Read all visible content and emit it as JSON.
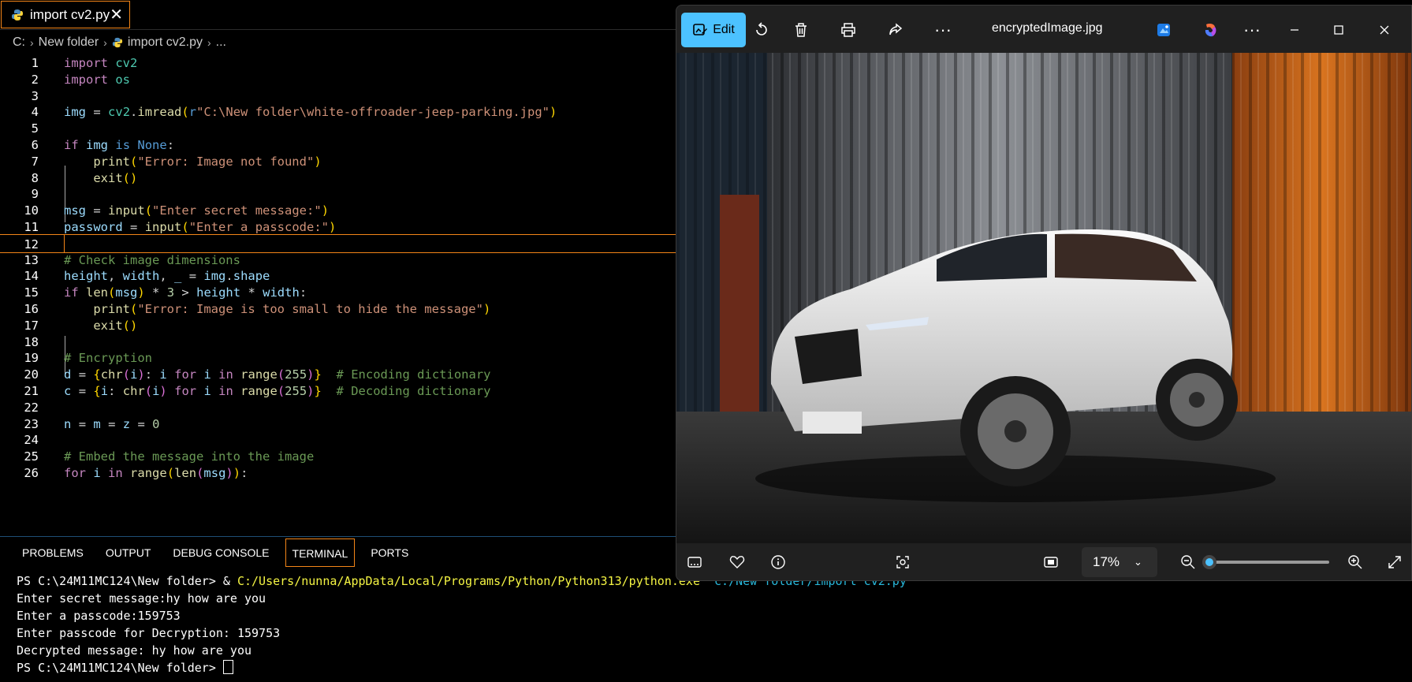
{
  "editor": {
    "tab": {
      "label": "import cv2.py",
      "close": "✕"
    },
    "breadcrumb": [
      "C:",
      "New folder",
      "import cv2.py",
      "..."
    ],
    "lines": [
      {
        "n": "1",
        "html": "<span class='kw'>import</span> <span class='mod'>cv2</span>"
      },
      {
        "n": "2",
        "html": "<span class='kw'>import</span> <span class='mod'>os</span>"
      },
      {
        "n": "3",
        "html": ""
      },
      {
        "n": "4",
        "html": "<span class='var'>img</span> <span class='op'>=</span> <span class='mod'>cv2</span>.<span class='fn'>imread</span><span class='br1'>(</span><span class='kw2'>r</span><span class='str'>\"C:\\New folder\\white-offroader-jeep-parking.jpg\"</span><span class='br1'>)</span>"
      },
      {
        "n": "5",
        "html": ""
      },
      {
        "n": "6",
        "html": "<span class='kw'>if</span> <span class='var'>img</span> <span class='kw2'>is</span> <span class='kw2'>None</span>:"
      },
      {
        "n": "7",
        "html": "    <span class='fn'>print</span><span class='br1'>(</span><span class='str'>\"Error: Image not found\"</span><span class='br1'>)</span>"
      },
      {
        "n": "8",
        "html": "    <span class='fn'>exit</span><span class='br1'>()</span>"
      },
      {
        "n": "9",
        "html": ""
      },
      {
        "n": "10",
        "html": "<span class='var'>msg</span> <span class='op'>=</span> <span class='fn'>input</span><span class='br1'>(</span><span class='str'>\"Enter secret message:\"</span><span class='br1'>)</span>"
      },
      {
        "n": "11",
        "html": "<span class='var'>password</span> <span class='op'>=</span> <span class='fn'>input</span><span class='br1'>(</span><span class='str'>\"Enter a passcode:\"</span><span class='br1'>)</span>"
      },
      {
        "n": "12",
        "html": "",
        "cur": true
      },
      {
        "n": "13",
        "html": "<span class='cm'># Check image dimensions</span>"
      },
      {
        "n": "14",
        "html": "<span class='var'>height</span>, <span class='var'>width</span>, <span class='var'>_</span> <span class='op'>=</span> <span class='var'>img</span>.<span class='var'>shape</span>"
      },
      {
        "n": "15",
        "html": "<span class='kw'>if</span> <span class='fn'>len</span><span class='br1'>(</span><span class='var'>msg</span><span class='br1'>)</span> <span class='op'>*</span> <span class='num'>3</span> <span class='op'>&gt;</span> <span class='var'>height</span> <span class='op'>*</span> <span class='var'>width</span>:"
      },
      {
        "n": "16",
        "html": "    <span class='fn'>print</span><span class='br1'>(</span><span class='str'>\"Error: Image is too small to hide the message\"</span><span class='br1'>)</span>"
      },
      {
        "n": "17",
        "html": "    <span class='fn'>exit</span><span class='br1'>()</span>"
      },
      {
        "n": "18",
        "html": ""
      },
      {
        "n": "19",
        "html": "<span class='cm'># Encryption</span>"
      },
      {
        "n": "20",
        "html": "<span class='var'>d</span> <span class='op'>=</span> <span class='br1'>{</span><span class='fn'>chr</span><span class='br2'>(</span><span class='var'>i</span><span class='br2'>)</span>: <span class='var'>i</span> <span class='kw'>for</span> <span class='var'>i</span> <span class='kw'>in</span> <span class='fn'>range</span><span class='br2'>(</span><span class='num'>255</span><span class='br2'>)</span><span class='br1'>}</span>  <span class='cm'># Encoding dictionary</span>"
      },
      {
        "n": "21",
        "html": "<span class='var'>c</span> <span class='op'>=</span> <span class='br1'>{</span><span class='var'>i</span>: <span class='fn'>chr</span><span class='br2'>(</span><span class='var'>i</span><span class='br2'>)</span> <span class='kw'>for</span> <span class='var'>i</span> <span class='kw'>in</span> <span class='fn'>range</span><span class='br2'>(</span><span class='num'>255</span><span class='br2'>)</span><span class='br1'>}</span>  <span class='cm'># Decoding dictionary</span>"
      },
      {
        "n": "22",
        "html": ""
      },
      {
        "n": "23",
        "html": "<span class='var'>n</span> <span class='op'>=</span> <span class='var'>m</span> <span class='op'>=</span> <span class='var'>z</span> <span class='op'>=</span> <span class='num'>0</span>"
      },
      {
        "n": "24",
        "html": ""
      },
      {
        "n": "25",
        "html": "<span class='cm'># Embed the message into the image</span>"
      },
      {
        "n": "26",
        "html": "<span class='kw'>for</span> <span class='var'>i</span> <span class='kw'>in</span> <span class='fn'>range</span><span class='br1'>(</span><span class='fn'>len</span><span class='br2'>(</span><span class='var'>msg</span><span class='br2'>)</span><span class='br1'>)</span>:"
      }
    ]
  },
  "panel": {
    "tabs": [
      "PROBLEMS",
      "OUTPUT",
      "DEBUG CONSOLE",
      "TERMINAL",
      "PORTS"
    ],
    "active_tab": "TERMINAL"
  },
  "terminal": {
    "prompt1": "PS C:\\24M11MC124\\New folder> & ",
    "python_path": "C:/Users/nunna/AppData/Local/Programs/Python/Python313/python.exe",
    "script_arg": " \"c:/New folder/import cv2.py\"",
    "lines": [
      "Enter secret message:hy how are you",
      "Enter a passcode:159753",
      "Enter passcode for Decryption: 159753",
      "Decrypted message: hy how are you"
    ],
    "prompt2": "PS C:\\24M11MC124\\New folder> "
  },
  "photos": {
    "edit_label": "Edit",
    "filename": "encryptedImage.jpg",
    "zoom": "17%",
    "zoom_level_fraction": 0.05,
    "accent": "#4cc2ff"
  }
}
